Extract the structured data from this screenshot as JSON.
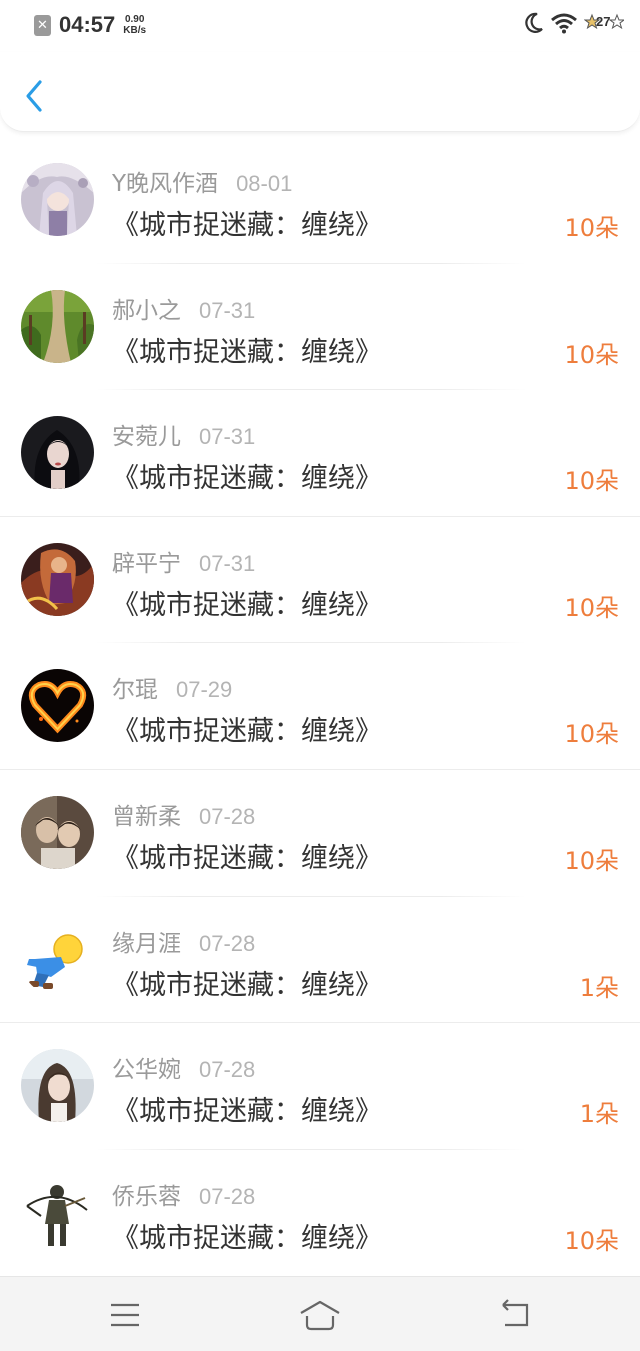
{
  "status_bar": {
    "time": "04:57",
    "speed_value": "0.90",
    "speed_unit": "KB/s",
    "battery": "27",
    "icons": [
      "notification-x-icon",
      "moon-icon",
      "wifi-icon",
      "battery-icon"
    ]
  },
  "header": {
    "back_icon": "chevron-left-icon",
    "accent_color": "#2a9de6"
  },
  "gifts": [
    {
      "name": "Y晚风作酒",
      "date": "08-01",
      "title": "《城市捉迷藏：缠绕》",
      "amount": "10朵",
      "avatar": "anime-girl"
    },
    {
      "name": "郝小之",
      "date": "07-31",
      "title": "《城市捉迷藏：缠绕》",
      "amount": "10朵",
      "avatar": "garden-path"
    },
    {
      "name": "安菀儿",
      "date": "07-31",
      "title": "《城市捉迷藏：缠绕》",
      "amount": "10朵",
      "avatar": "dark-portrait"
    },
    {
      "name": "辟平宁",
      "date": "07-31",
      "title": "《城市捉迷藏：缠绕》",
      "amount": "10朵",
      "avatar": "fantasy-warrior"
    },
    {
      "name": "尔琨",
      "date": "07-29",
      "title": "《城市捉迷藏：缠绕》",
      "amount": "10朵",
      "avatar": "fire-heart"
    },
    {
      "name": "曾新柔",
      "date": "07-28",
      "title": "《城市捉迷藏：缠绕》",
      "amount": "10朵",
      "avatar": "couple-photo"
    },
    {
      "name": "缘月涯",
      "date": "07-28",
      "title": "《城市捉迷藏：缠绕》",
      "amount": "1朵",
      "avatar": "default-doll"
    },
    {
      "name": "公华婉",
      "date": "07-28",
      "title": "《城市捉迷藏：缠绕》",
      "amount": "1朵",
      "avatar": "girl-portrait"
    },
    {
      "name": "侨乐蓉",
      "date": "07-28",
      "title": "《城市捉迷藏：缠绕》",
      "amount": "10朵",
      "avatar": "archer-figure"
    }
  ],
  "colors": {
    "amount": "#ee7d3c",
    "name": "#9a9a9a",
    "date": "#b4b4b4",
    "title": "#333333"
  },
  "nav": {
    "icons": [
      "menu-icon",
      "home-icon",
      "back-icon"
    ]
  }
}
